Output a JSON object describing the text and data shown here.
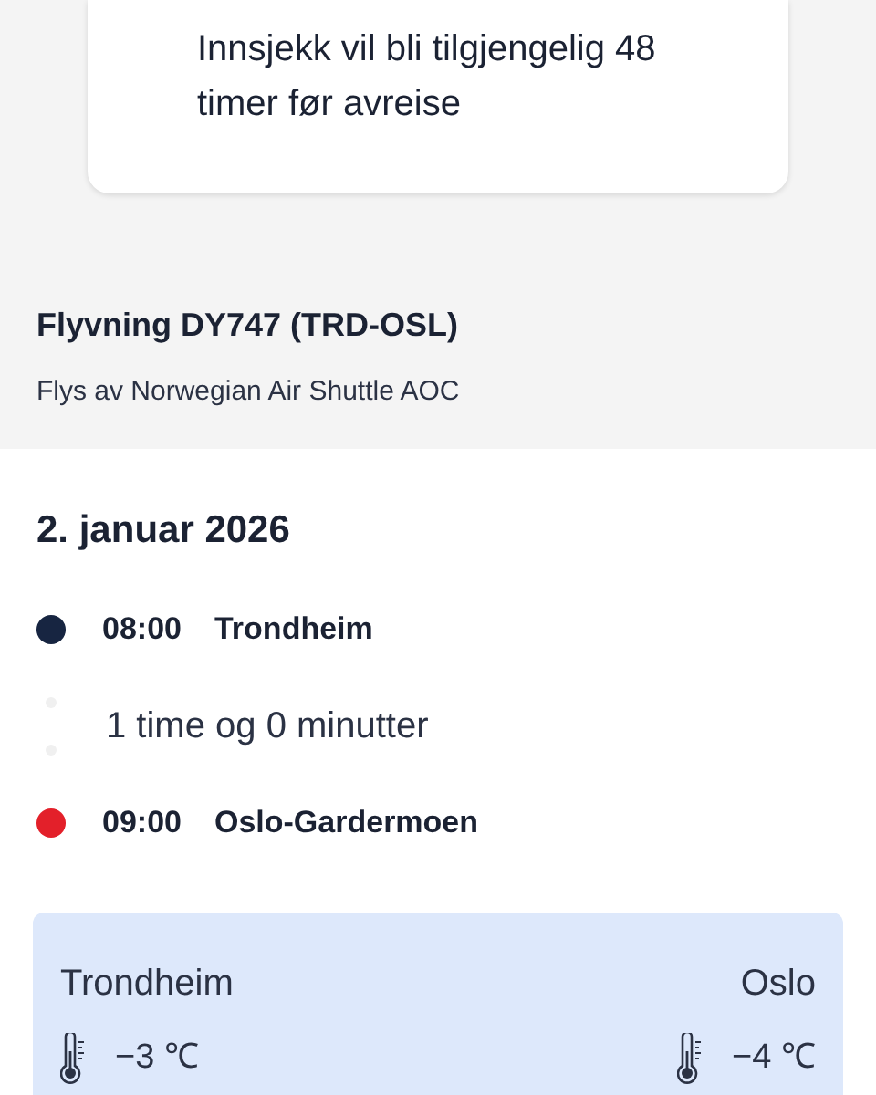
{
  "checkin_card": {
    "message": "Innsjekk vil bli tilgjengelig 48 timer før avreise"
  },
  "flight": {
    "title": "Flyvning DY747 (TRD-OSL)",
    "operator": "Flys av Norwegian Air Shuttle AOC"
  },
  "itinerary": {
    "date": "2. januar 2026",
    "stops": [
      {
        "time": "08:00",
        "place": "Trondheim",
        "color": "#172541"
      },
      {
        "time": "09:00",
        "place": "Oslo-Gardermoen",
        "color": "#e3202a"
      }
    ],
    "duration": "1 time og 0 minutter"
  },
  "weather": [
    {
      "city": "Trondheim",
      "temperature": "−3 ℃"
    },
    {
      "city": "Oslo",
      "temperature": "−4 ℃"
    }
  ]
}
